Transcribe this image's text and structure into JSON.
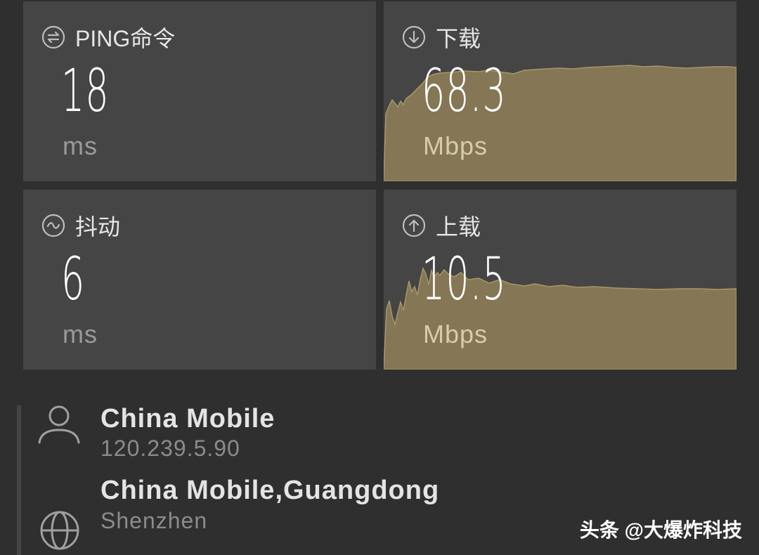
{
  "metrics": {
    "ping": {
      "label": "PING命令",
      "value": "18",
      "unit": "ms",
      "icon": "ping-icon"
    },
    "download": {
      "label": "下载",
      "value": "68.3",
      "unit": "Mbps",
      "icon": "download-arrow-icon"
    },
    "jitter": {
      "label": "抖动",
      "value": "6",
      "unit": "ms",
      "icon": "jitter-wave-icon"
    },
    "upload": {
      "label": "上载",
      "value": "10.5",
      "unit": "Mbps",
      "icon": "upload-arrow-icon"
    }
  },
  "provider": {
    "name": "China Mobile",
    "ip": "120.239.5.90",
    "icon": "user-icon"
  },
  "server": {
    "name": "China Mobile,Guangdong",
    "city": "Shenzhen",
    "icon": "globe-icon"
  },
  "watermark": "头条 @大爆炸科技",
  "colors": {
    "background": "#2f2f2f",
    "card": "#454545",
    "graph_fill": "#857755",
    "graph_line": "#a8976a",
    "text_primary": "#ffffff",
    "text_muted": "#9a9a9a"
  }
}
